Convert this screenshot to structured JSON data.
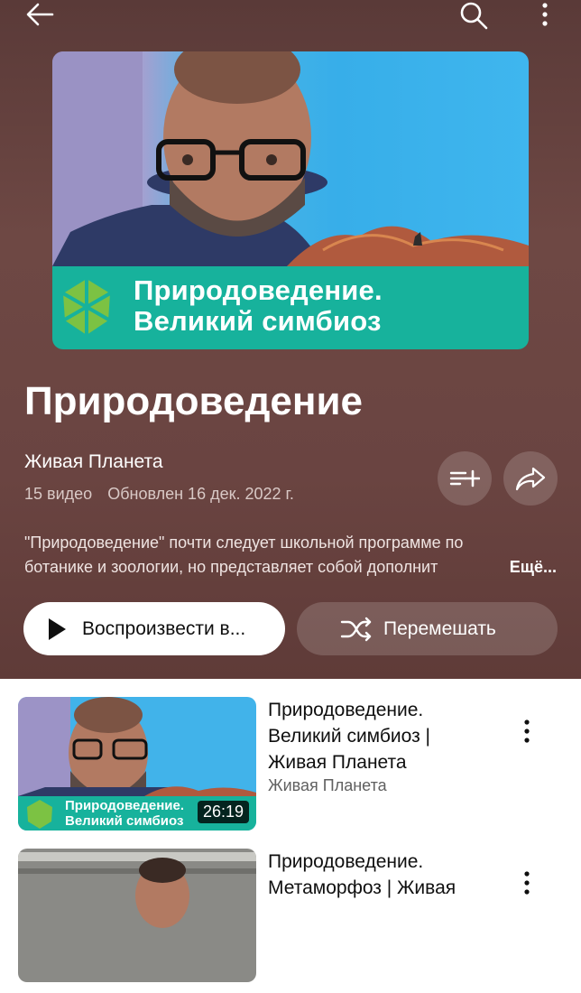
{
  "header": {
    "back_icon": "arrow-left-icon",
    "search_icon": "search-icon",
    "menu_icon": "more-vertical-icon"
  },
  "playlist": {
    "cover_title_line1": "Природоведение.",
    "cover_title_line2": "Великий симбиоз",
    "title": "Природоведение",
    "author": "Живая Планета",
    "video_count": "15 видео",
    "updated": "Обновлен 16 дек. 2022 г.",
    "description_line1": "\"Природоведение\" почти следует школьной программе по",
    "description_line2": "ботанике и зоологии, но представляет собой дополнит",
    "more_label": "Ещё...",
    "play_label": "Воспроизвести в...",
    "shuffle_label": "Перемешать"
  },
  "videos": [
    {
      "title_line1": "Природоведение.",
      "title_line2": "Великий симбиоз |",
      "title_line3": "Живая Планета",
      "channel": "Живая Планета",
      "duration": "26:19",
      "thumb_line1": "Природоведение.",
      "thumb_line2": "Великий симбиоз"
    },
    {
      "title_line1": "Природоведение.",
      "title_line2": "Метаморфоз | Живая"
    }
  ],
  "colors": {
    "hero_background": "#6a4441",
    "banner_teal": "#17b29c"
  }
}
